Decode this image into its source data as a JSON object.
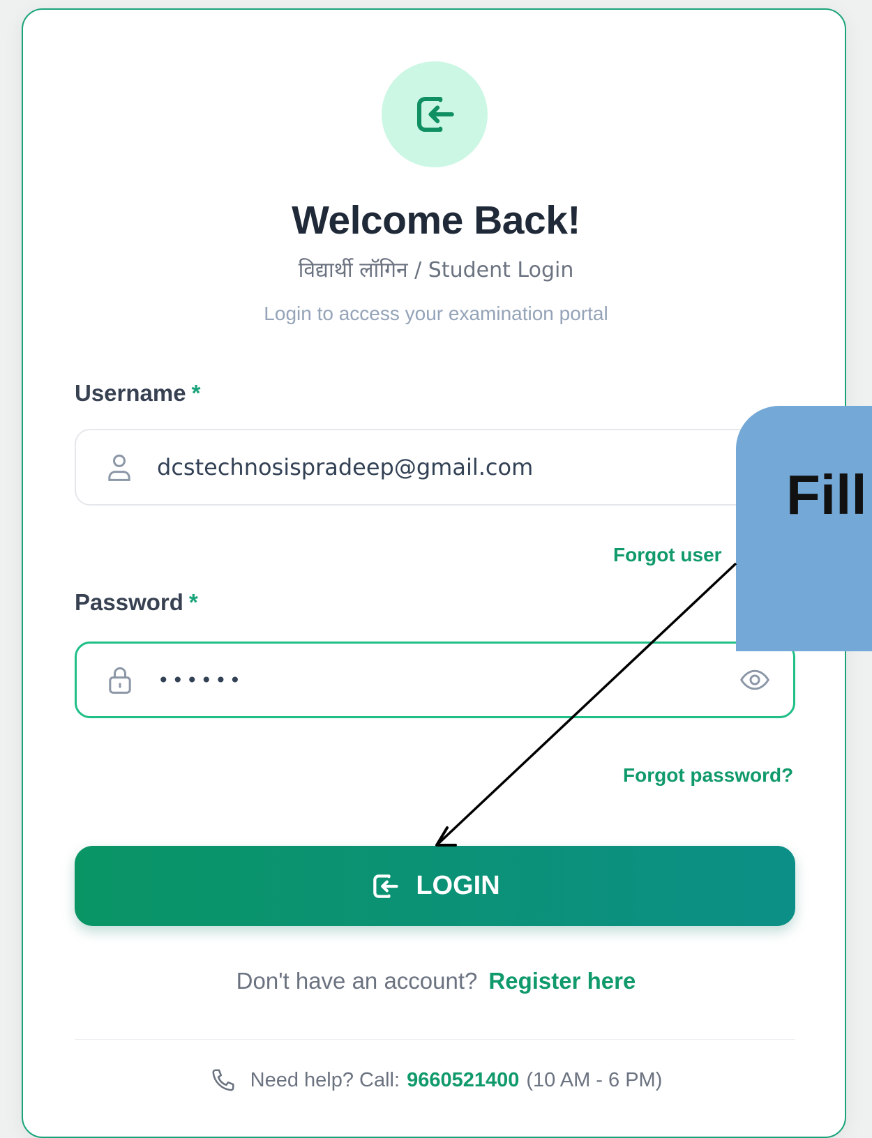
{
  "login": {
    "title": "Welcome Back!",
    "subtitle": "विद्यार्थी लॉगिन / Student Login",
    "tagline": "Login to access your examination portal",
    "username_label": "Username",
    "password_label": "Password",
    "required_mark": "*",
    "username_value": "dcstechnosispradeep@gmail.com",
    "password_value": "••••••",
    "forgot_username": "Forgot user",
    "forgot_password": "Forgot password?",
    "login_button": "LOGIN",
    "no_account_text": "Don't have an account?",
    "register_link": "Register here",
    "help_prefix": "Need help? Call:",
    "help_phone": "9660521400",
    "help_hours": "(10 AM - 6 PM)"
  },
  "annotation": {
    "callout_text": "Fill"
  },
  "icons": {
    "header": "login-icon",
    "username": "user-icon",
    "password": "lock-icon",
    "toggle": "eye-icon",
    "button": "login-icon",
    "help": "phone-icon"
  },
  "colors": {
    "accent": "#109a6b",
    "button_start": "#0a9565",
    "button_end": "#0c8f86",
    "icon_circle": "#ccf7e5",
    "callout": "#74a8d6"
  }
}
